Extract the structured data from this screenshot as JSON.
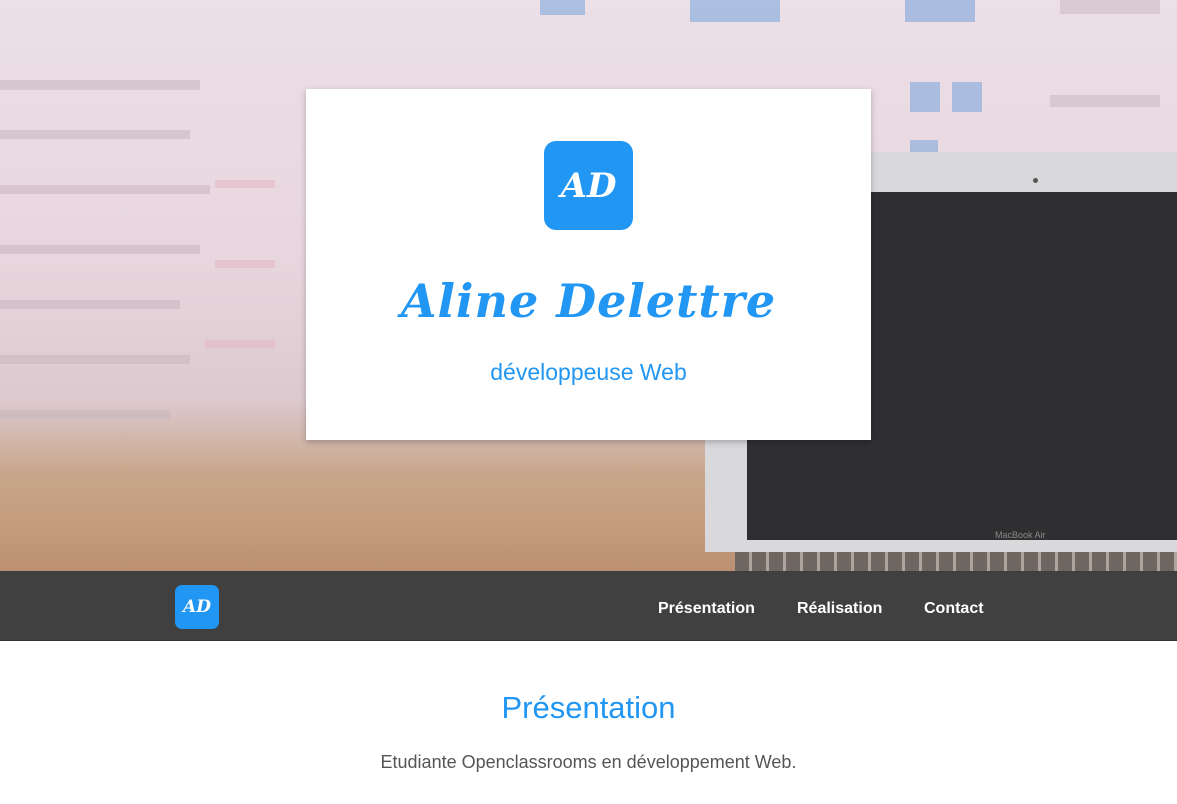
{
  "header": {
    "logo_text": "AD",
    "name": "Aline Delettre",
    "role": "développeuse Web",
    "laptop_brand": "MacBook Air"
  },
  "navbar": {
    "logo_text": "AD",
    "links": [
      {
        "label": "Présentation"
      },
      {
        "label": "Réalisation"
      },
      {
        "label": "Contact"
      }
    ]
  },
  "presentation": {
    "title": "Présentation",
    "text": "Etudiante Openclassrooms en développement Web."
  },
  "colors": {
    "accent": "#2196f3",
    "navbar_bg": "#404040",
    "text": "#555555"
  }
}
